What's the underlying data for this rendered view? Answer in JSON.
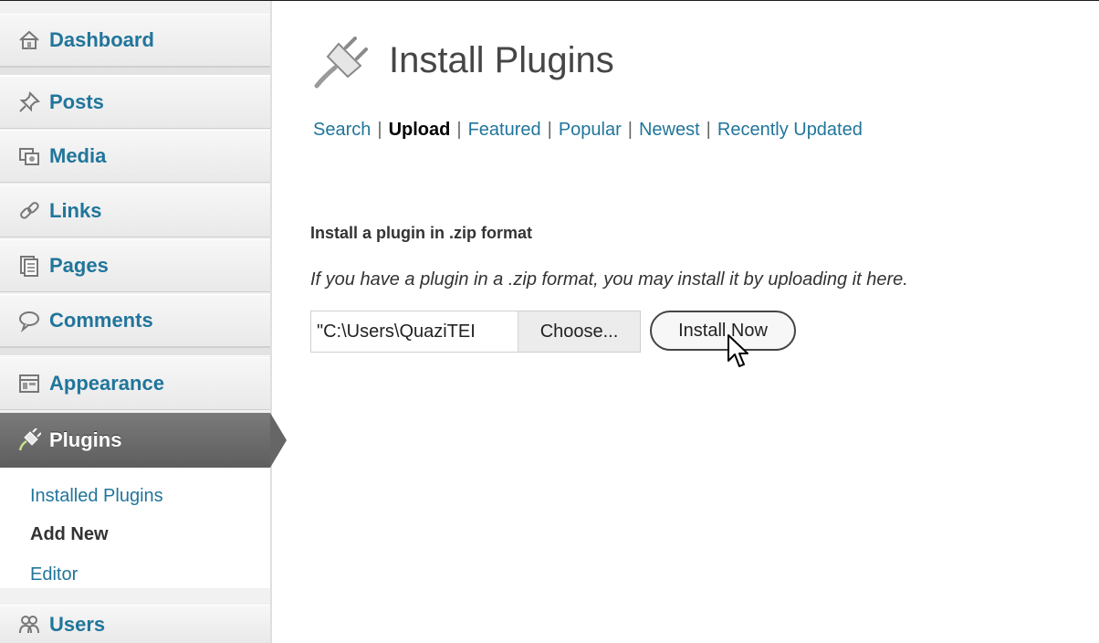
{
  "sidebar": {
    "items": [
      {
        "label": "Dashboard",
        "icon": "home-icon"
      },
      {
        "label": "Posts",
        "icon": "pushpin-icon"
      },
      {
        "label": "Media",
        "icon": "media-icon"
      },
      {
        "label": "Links",
        "icon": "link-icon"
      },
      {
        "label": "Pages",
        "icon": "pages-icon"
      },
      {
        "label": "Comments",
        "icon": "comment-bubble-icon"
      },
      {
        "label": "Appearance",
        "icon": "appearance-icon"
      },
      {
        "label": "Plugins",
        "icon": "plug-icon"
      },
      {
        "label": "Users",
        "icon": "users-icon"
      }
    ],
    "plugins_submenu": [
      {
        "label": "Installed Plugins"
      },
      {
        "label": "Add New"
      },
      {
        "label": "Editor"
      }
    ]
  },
  "page": {
    "title": "Install Plugins",
    "tabs": [
      {
        "label": "Search"
      },
      {
        "label": "Upload"
      },
      {
        "label": "Featured"
      },
      {
        "label": "Popular"
      },
      {
        "label": "Newest"
      },
      {
        "label": "Recently Updated"
      }
    ],
    "tab_separator": "|",
    "section_heading": "Install a plugin in .zip format",
    "section_description": "If you have a plugin in a .zip format, you may install it by uploading it here.",
    "file_input_value": "\"C:\\Users\\QuaziTEI",
    "choose_button": "Choose...",
    "install_button": "Install Now"
  },
  "colors": {
    "link": "#21759b",
    "active_menu": "#6d6d6d"
  }
}
